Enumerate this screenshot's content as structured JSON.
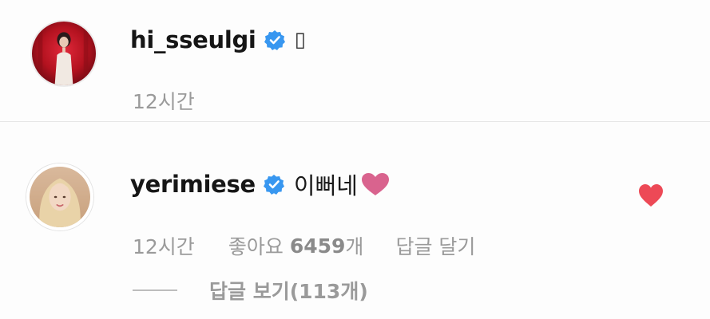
{
  "caption": {
    "username": "hi_sseulgi",
    "text": "▯",
    "time": "12시간",
    "avatar_icon": "profile-photo",
    "verified_icon": "verified-badge"
  },
  "reply": {
    "username": "yerimiese",
    "text": "이뻐네",
    "inline_emoji": "pink-heart-emoji",
    "time": "12시간",
    "likes_label": "좋아요",
    "likes_count": "6459",
    "likes_unit": "개",
    "reply_action": "답글 달기",
    "liked_icon": "red-heart-icon",
    "view_replies": "답글 보기(113개)"
  },
  "colors": {
    "username": "#161616",
    "muted": "#9a9a9a",
    "verified_blue": "#3897f0",
    "like_red": "#ed4956",
    "pink_heart": "#d9638e"
  }
}
